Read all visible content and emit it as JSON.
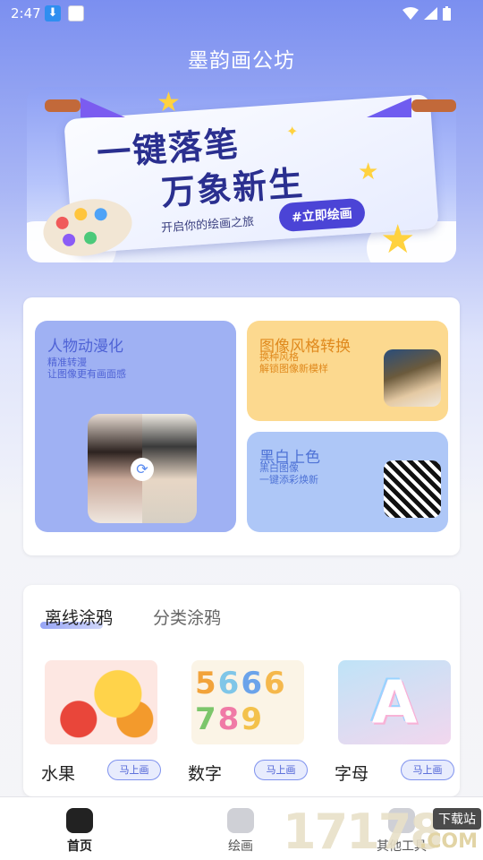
{
  "status": {
    "time": "2:47"
  },
  "app_title": "墨韵画公坊",
  "banner": {
    "line1": "一键落笔",
    "line2": "万象新生",
    "subtitle": "开启你的绘画之旅",
    "tag": "#立即绘画"
  },
  "features": [
    {
      "title": "人物动漫化",
      "lines": [
        "精准转漫",
        "让图像更有画面感"
      ]
    },
    {
      "title": "图像风格转换",
      "lines": [
        "换种风格",
        "解锁图像新模样"
      ]
    },
    {
      "title": "黑白上色",
      "lines": [
        "黑白图像",
        "一键添彩焕新"
      ]
    }
  ],
  "tabs": {
    "active": "离线涂鸦",
    "inactive": "分类涂鸦"
  },
  "cards": [
    {
      "name": "水果",
      "button": "马上画"
    },
    {
      "name": "数字",
      "button": "马上画"
    },
    {
      "name": "字母",
      "button": "马上画"
    }
  ],
  "nav": [
    {
      "label": "首页",
      "icon": "home-icon"
    },
    {
      "label": "绘画",
      "icon": "briefcase-icon"
    },
    {
      "label": "其他工具",
      "icon": "tools-icon"
    }
  ],
  "watermark": {
    "number": "17178",
    "tag": "下载站",
    "domain": ".COM"
  },
  "colors": {
    "accent": "#4f63d6",
    "orange": "#e08a1e"
  }
}
